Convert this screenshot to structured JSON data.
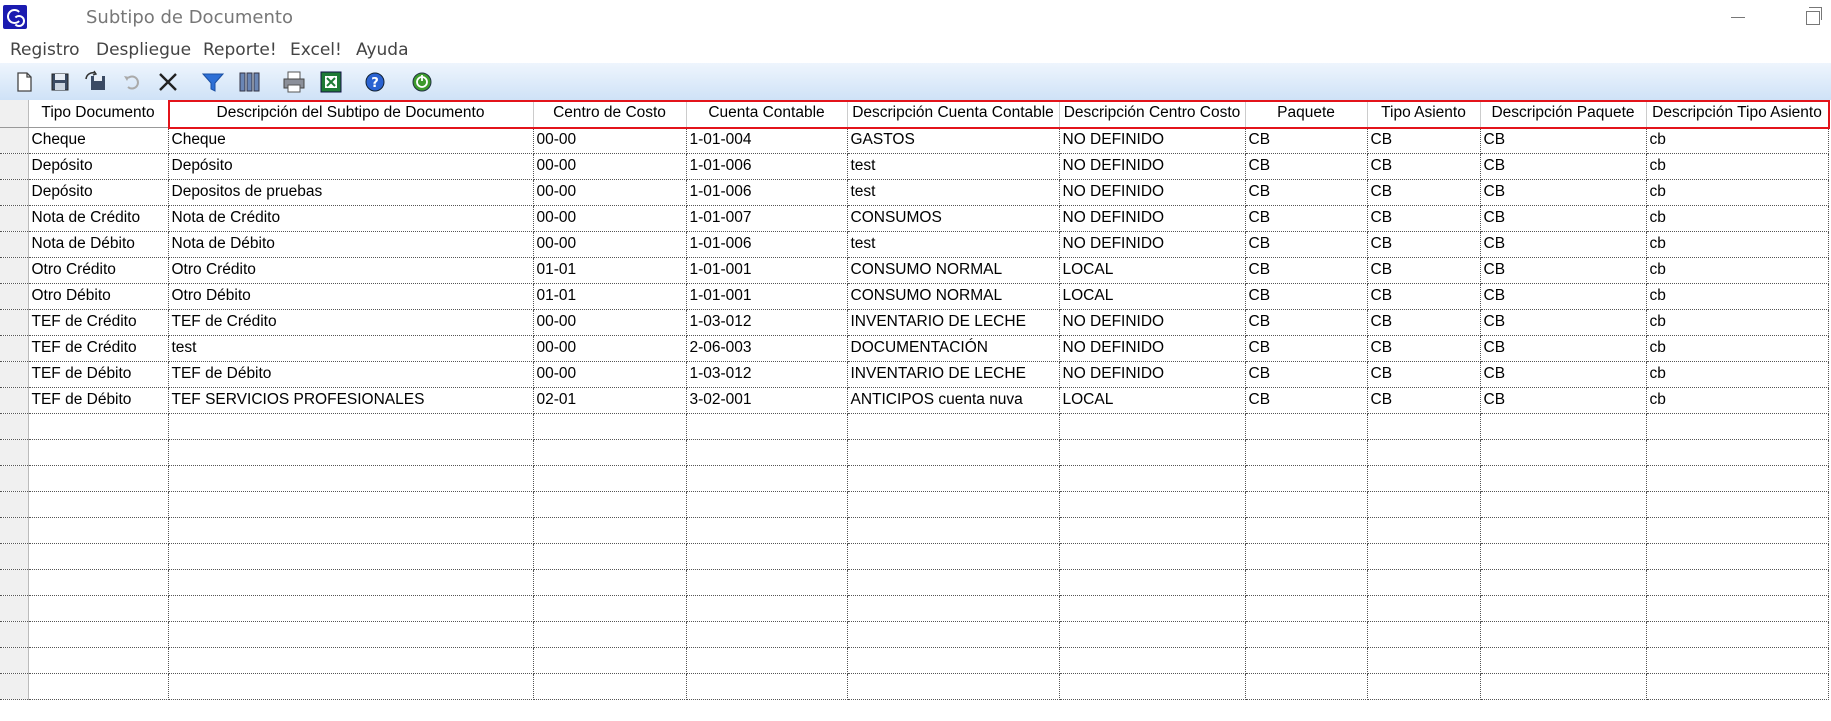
{
  "window": {
    "title": "Subtipo de Documento"
  },
  "menu": [
    "Registro",
    "Despliegue",
    "Reporte!",
    "Excel!",
    "Ayuda"
  ],
  "toolbar": {
    "buttons": [
      {
        "name": "new-document-icon"
      },
      {
        "name": "save-icon"
      },
      {
        "name": "save-as-icon"
      },
      {
        "name": "undo-icon"
      },
      {
        "name": "delete-icon"
      },
      {
        "name": "filter-icon"
      },
      {
        "name": "columns-icon"
      },
      {
        "name": "print-icon"
      },
      {
        "name": "excel-icon"
      },
      {
        "name": "help-icon"
      },
      {
        "name": "exit-icon"
      }
    ]
  },
  "table": {
    "columns": [
      "Tipo Documento",
      "Descripción del Subtipo de Documento",
      "Centro de Costo",
      "Cuenta Contable",
      "Descripción Cuenta Contable",
      "Descripción Centro Costo",
      "Paquete",
      "Tipo Asiento",
      "Descripción Paquete",
      "Descripción Tipo Asiento"
    ],
    "rows": [
      [
        "Cheque",
        "Cheque",
        "00-00",
        "1-01-004",
        "GASTOS",
        "NO DEFINIDO",
        "CB",
        "CB",
        "CB",
        "cb"
      ],
      [
        "Depósito",
        "Depósito",
        "00-00",
        "1-01-006",
        "test",
        "NO DEFINIDO",
        "CB",
        "CB",
        "CB",
        "cb"
      ],
      [
        "Depósito",
        "Depositos de pruebas",
        "00-00",
        "1-01-006",
        "test",
        "NO DEFINIDO",
        "CB",
        "CB",
        "CB",
        "cb"
      ],
      [
        "Nota de Crédito",
        "Nota de Crédito",
        "00-00",
        "1-01-007",
        "CONSUMOS",
        "NO DEFINIDO",
        "CB",
        "CB",
        "CB",
        "cb"
      ],
      [
        "Nota de Débito",
        "Nota de Débito",
        "00-00",
        "1-01-006",
        "test",
        "NO DEFINIDO",
        "CB",
        "CB",
        "CB",
        "cb"
      ],
      [
        "Otro Crédito",
        "Otro Crédito",
        "01-01",
        "1-01-001",
        "CONSUMO NORMAL",
        "LOCAL",
        "CB",
        "CB",
        "CB",
        "cb"
      ],
      [
        "Otro Débito",
        "Otro Débito",
        "01-01",
        "1-01-001",
        "CONSUMO NORMAL",
        "LOCAL",
        "CB",
        "CB",
        "CB",
        "cb"
      ],
      [
        "TEF de Crédito",
        "TEF de Crédito",
        "00-00",
        "1-03-012",
        "INVENTARIO DE LECHE",
        "NO DEFINIDO",
        "CB",
        "CB",
        "CB",
        "cb"
      ],
      [
        "TEF de Crédito",
        "test",
        "00-00",
        "2-06-003",
        "DOCUMENTACIÓN",
        "NO DEFINIDO",
        "CB",
        "CB",
        "CB",
        "cb"
      ],
      [
        "TEF de Débito",
        "TEF de Débito",
        "00-00",
        "1-03-012",
        "INVENTARIO DE LECHE",
        "NO DEFINIDO",
        "CB",
        "CB",
        "CB",
        "cb"
      ],
      [
        "TEF de Débito",
        "TEF SERVICIOS PROFESIONALES",
        "02-01",
        "3-02-001",
        "ANTICIPOS cuenta nuva",
        "LOCAL",
        "CB",
        "CB",
        "CB",
        "cb"
      ]
    ],
    "empty_row_count": 11
  }
}
